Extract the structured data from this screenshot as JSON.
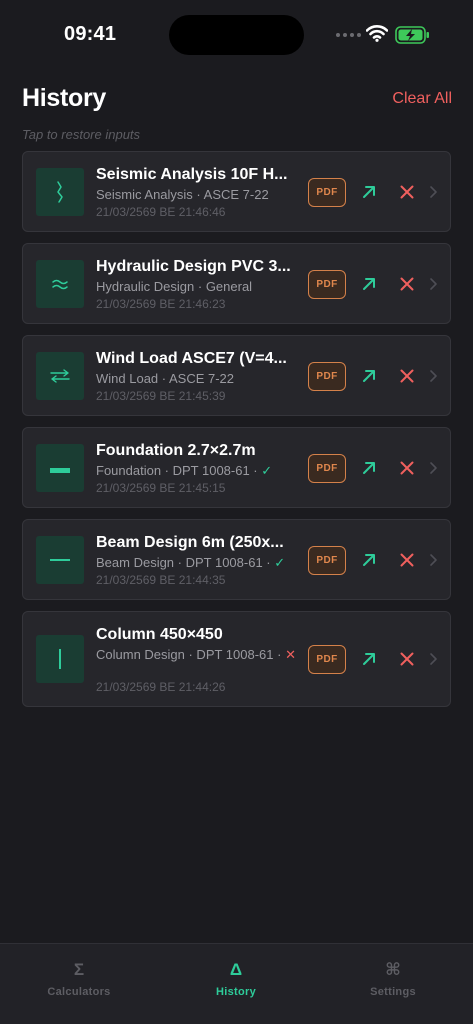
{
  "status": {
    "time": "09:41"
  },
  "header": {
    "title": "History",
    "clear_all": "Clear All",
    "hint": "Tap to restore inputs"
  },
  "colors": {
    "accent": "#2ecc9a",
    "danger": "#f0605e",
    "pdf": "#e0874d",
    "background": "#1b1b1f"
  },
  "items": [
    {
      "title": "Seismic Analysis 10F H...",
      "subtitle": "Seismic Analysis · ASCE 7-22",
      "status_mark": "",
      "date": "21/03/2569 BE 21:46:46",
      "icon": "seismic-wave-icon",
      "pdf_label": "PDF"
    },
    {
      "title": "Hydraulic Design PVC 3...",
      "subtitle": "Hydraulic Design · General",
      "status_mark": "",
      "date": "21/03/2569 BE 21:46:23",
      "icon": "water-waves-icon",
      "pdf_label": "PDF"
    },
    {
      "title": "Wind Load ASCE7 (V=4...",
      "subtitle": "Wind Load · ASCE 7-22",
      "status_mark": "",
      "date": "21/03/2569 BE 21:45:39",
      "icon": "wind-arrows-icon",
      "pdf_label": "PDF"
    },
    {
      "title": "Foundation 2.7×2.7m",
      "subtitle": "Foundation · DPT 1008-61 ·",
      "status_mark": "✓",
      "date": "21/03/2569 BE 21:45:15",
      "icon": "foundation-slab-icon",
      "pdf_label": "PDF"
    },
    {
      "title": "Beam Design 6m (250x...",
      "subtitle": "Beam Design · DPT 1008-61 ·",
      "status_mark": "✓",
      "date": "21/03/2569 BE 21:44:35",
      "icon": "beam-icon",
      "pdf_label": "PDF"
    },
    {
      "title": "Column 450×450",
      "subtitle": "Column Design · DPT 1008-61 ·",
      "status_mark": "✕",
      "date": "21/03/2569 BE 21:44:26",
      "icon": "column-icon",
      "pdf_label": "PDF"
    }
  ],
  "tabs": [
    {
      "label": "Calculators",
      "glyph": "Σ",
      "icon": "sigma-icon",
      "active": false
    },
    {
      "label": "History",
      "glyph": "Δ",
      "icon": "delta-icon",
      "active": true
    },
    {
      "label": "Settings",
      "glyph": "⌘",
      "icon": "command-icon",
      "active": false
    }
  ]
}
